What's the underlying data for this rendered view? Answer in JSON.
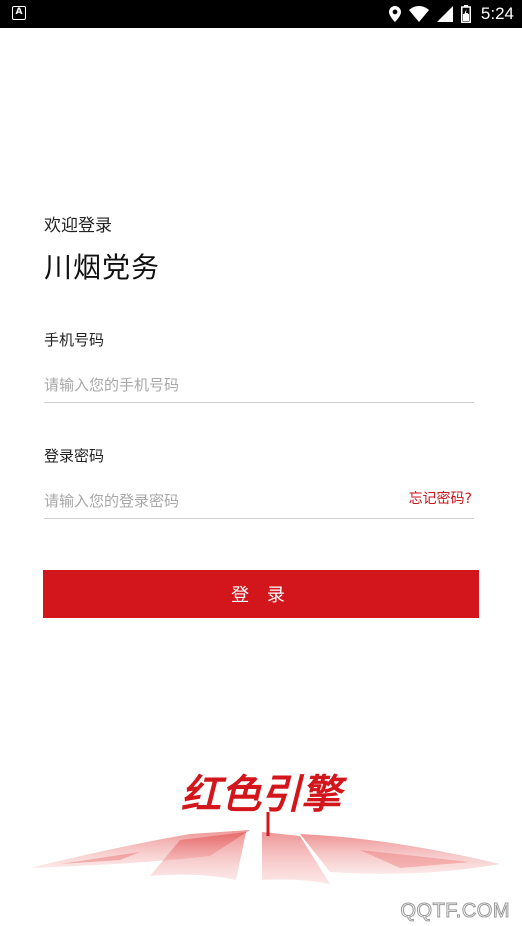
{
  "status_bar": {
    "time": "5:24",
    "icons": [
      "notification-a-icon",
      "location-icon",
      "wifi-icon",
      "signal-icon",
      "battery-icon"
    ]
  },
  "header": {
    "welcome": "欢迎登录",
    "title": "川烟党务"
  },
  "form": {
    "phone": {
      "label": "手机号码",
      "placeholder": "请输入您的手机号码",
      "value": ""
    },
    "password": {
      "label": "登录密码",
      "placeholder": "请输入您的登录密码",
      "value": ""
    },
    "forgot_password": "忘记密码?",
    "login_button": "登 录"
  },
  "logo": {
    "text": "红色引擎"
  },
  "watermark": "QQTF.COM",
  "colors": {
    "accent": "#d2161c",
    "status_bar": "#000000",
    "background": "#ffffff"
  }
}
